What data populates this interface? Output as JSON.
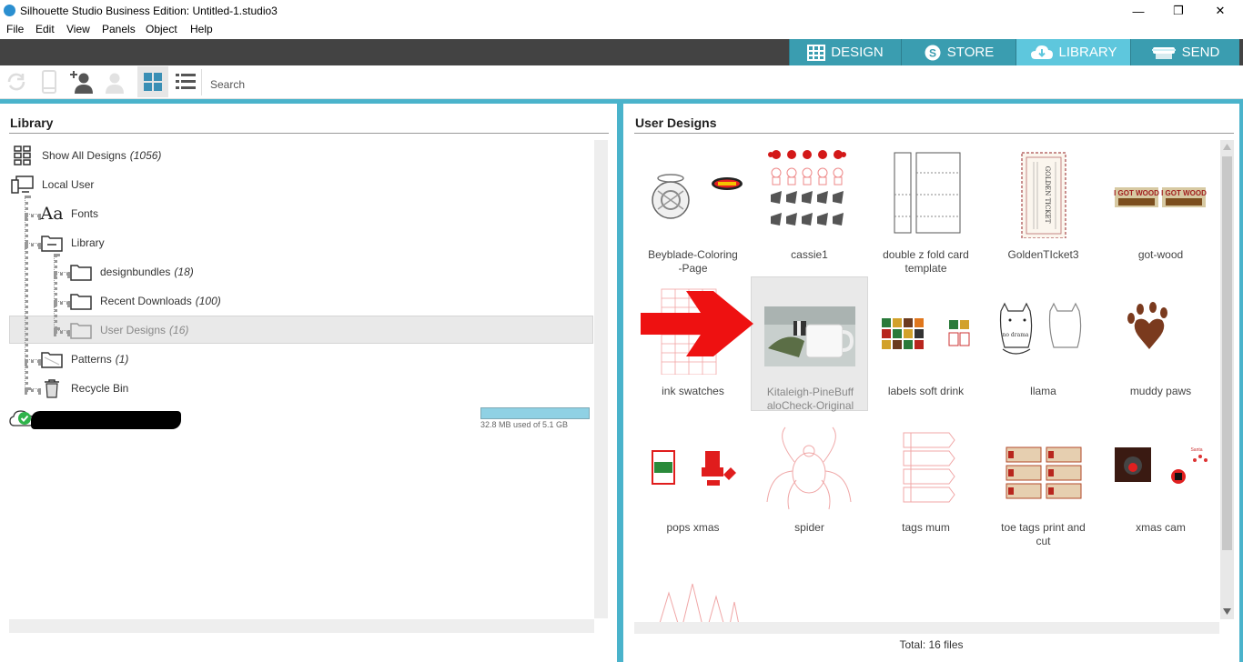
{
  "window": {
    "title": "Silhouette Studio Business Edition: Untitled-1.studio3",
    "minimize": "—",
    "maximize": "❐",
    "close": "✕"
  },
  "menu": [
    "File",
    "Edit",
    "View",
    "Panels",
    "Object",
    "Help"
  ],
  "nav_tabs": [
    {
      "label": "DESIGN",
      "icon": "design-grid-icon",
      "active": false
    },
    {
      "label": "STORE",
      "icon": "store-s-icon",
      "active": false
    },
    {
      "label": "LIBRARY",
      "icon": "cloud-download-icon",
      "active": true
    },
    {
      "label": "SEND",
      "icon": "cutter-machine-icon",
      "active": false
    }
  ],
  "toolbar": {
    "search_label": "Search",
    "icons": [
      "sync-icon",
      "device-icon",
      "add-user-icon",
      "user-icon",
      "grid-view-icon",
      "list-view-icon"
    ]
  },
  "library": {
    "title": "Library",
    "tree": [
      {
        "label": "Show All Designs",
        "count": "(1056)",
        "icon": "show-all-grid-icon"
      },
      {
        "label": "Local User",
        "count": "",
        "icon": "computer-icon"
      },
      {
        "label": "Fonts",
        "count": "",
        "icon": "fonts-aa-icon"
      },
      {
        "label": "Library",
        "count": "",
        "icon": "folder-collapse-icon"
      },
      {
        "label": "designbundles",
        "count": "(18)",
        "icon": "folder-icon"
      },
      {
        "label": "Recent Downloads",
        "count": "(100)",
        "icon": "folder-icon"
      },
      {
        "label": "User Designs",
        "count": "(16)",
        "icon": "folder-icon",
        "selected": true
      },
      {
        "label": "Patterns",
        "count": "(1)",
        "icon": "patterns-folder-icon"
      },
      {
        "label": "Recycle Bin",
        "count": "",
        "icon": "recycle-bin-icon"
      }
    ],
    "cloud": {
      "icon": "cloud-check-icon",
      "usage_text": "32.8 MB used of 5.1 GB",
      "usage_fraction": 1.0
    }
  },
  "user_designs": {
    "title": "User Designs",
    "items": [
      {
        "label": "Beyblade-Coloring\n-Page"
      },
      {
        "label": "cassie1"
      },
      {
        "label": "double z fold card\ntemplate"
      },
      {
        "label": "GoldenTIcket3"
      },
      {
        "label": "got-wood"
      },
      {
        "label": "ink swatches"
      },
      {
        "label": "Kitaleigh-PineBuff\naloCheck-Original",
        "selected": true
      },
      {
        "label": "labels soft drink"
      },
      {
        "label": "llama"
      },
      {
        "label": "muddy paws"
      },
      {
        "label": "pops xmas"
      },
      {
        "label": "spider"
      },
      {
        "label": "tags mum"
      },
      {
        "label": "toe tags print and\ncut"
      },
      {
        "label": "xmas cam"
      },
      {
        "label": ""
      }
    ],
    "total": "Total: 16 files"
  },
  "thumb_text": {
    "golden_ticket": "GOLDEN TICKET",
    "got_wood": "I GOT WOOD"
  },
  "colors": {
    "accent": "#4ab3cb",
    "tab_active": "#5ec7dd",
    "tab": "#3a9db0",
    "tabbar": "#434343",
    "arrow": "#ee1111"
  }
}
